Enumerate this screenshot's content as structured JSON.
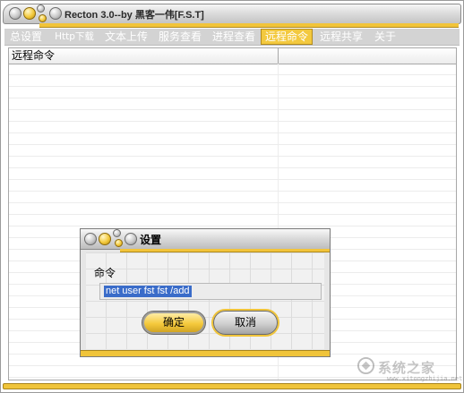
{
  "window": {
    "title": "Recton 3.0--by 黑客一伟[F.S.T]"
  },
  "tabs": [
    {
      "label": "总设置"
    },
    {
      "label": "Http下载"
    },
    {
      "label": "文本上传"
    },
    {
      "label": "服务查看"
    },
    {
      "label": "进程查看"
    },
    {
      "label": "远程命令",
      "active": true
    },
    {
      "label": "远程共享"
    },
    {
      "label": "关于"
    }
  ],
  "list": {
    "columns": [
      "远程命令",
      ""
    ]
  },
  "dialog": {
    "title": "设置",
    "field_label": "命令",
    "command_value": "net user fst fst /add",
    "ok_label": "确定",
    "cancel_label": "取消"
  },
  "watermark": {
    "text": "系统之家",
    "url": "www.xitongzhijia.net"
  },
  "colors": {
    "accent": "#f3c93f",
    "selection": "#3a6cc9"
  }
}
